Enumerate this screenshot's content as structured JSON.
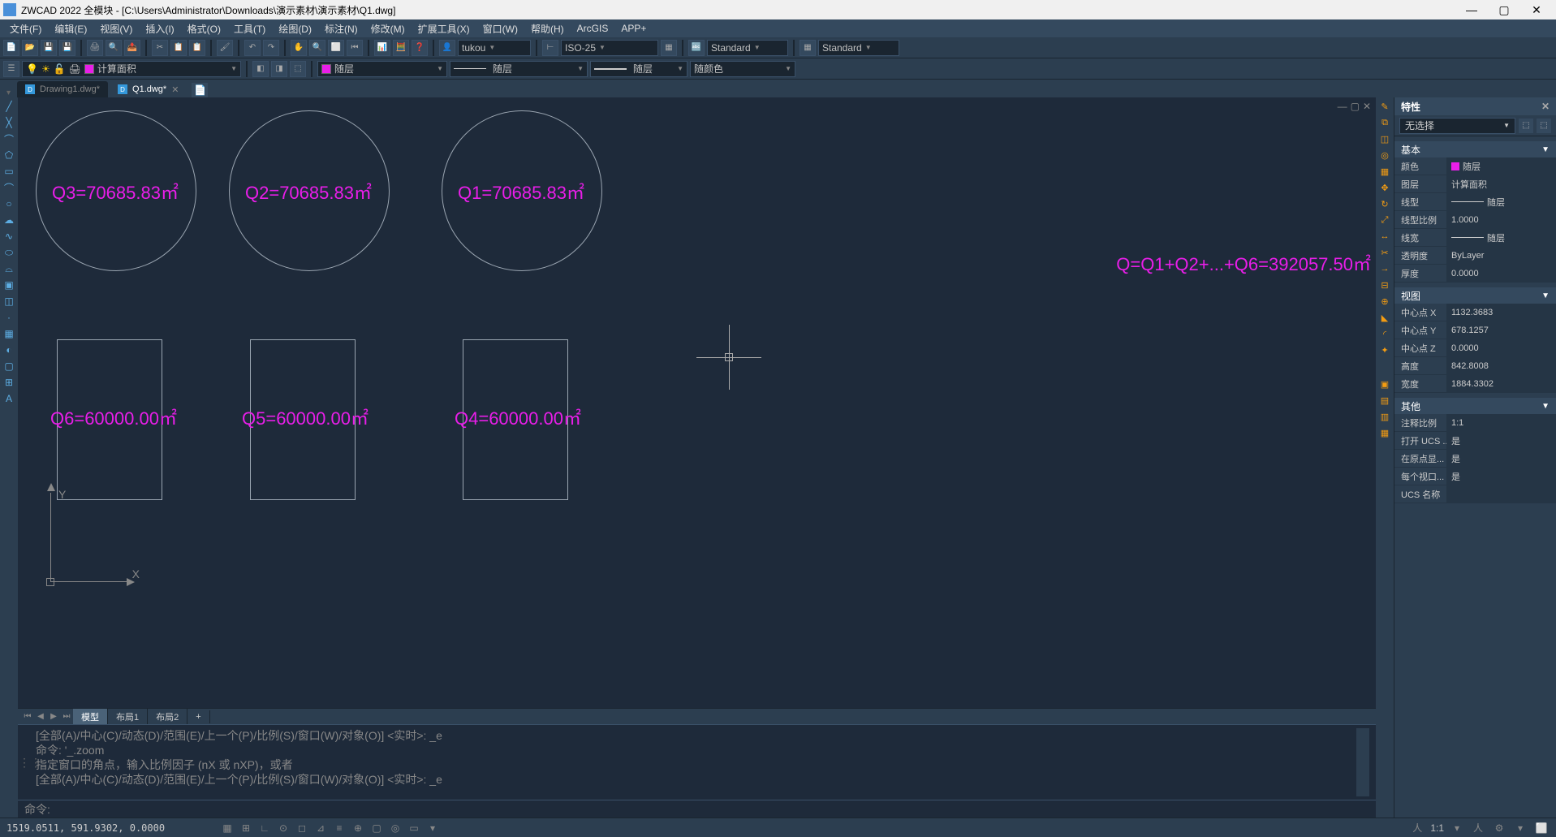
{
  "titlebar": {
    "title": "ZWCAD 2022 全模块 - [C:\\Users\\Administrator\\Downloads\\演示素材\\演示素材\\Q1.dwg]"
  },
  "menu": {
    "items": [
      "文件(F)",
      "编辑(E)",
      "视图(V)",
      "插入(I)",
      "格式(O)",
      "工具(T)",
      "绘图(D)",
      "标注(N)",
      "修改(M)",
      "扩展工具(X)",
      "窗口(W)",
      "帮助(H)",
      "ArcGIS",
      "APP+"
    ]
  },
  "toolbar1": {
    "combo1": "tukou",
    "combo2": "ISO-25",
    "combo3": "Standard",
    "combo4": "Standard"
  },
  "toolbar2": {
    "layer": "计算面积",
    "linetype_combo": "随层",
    "lineweight_combo": "随层",
    "color_combo": "随颜色",
    "plot_combo": "随层"
  },
  "tabs": {
    "t1": "Drawing1.dwg*",
    "t2": "Q1.dwg*"
  },
  "drawing": {
    "q1": "Q1=70685.83㎡",
    "q2": "Q2=70685.83㎡",
    "q3": "Q3=70685.83㎡",
    "q4": "Q4=60000.00㎡",
    "q5": "Q5=60000.00㎡",
    "q6": "Q6=60000.00㎡",
    "sum": "Q=Q1+Q2+...+Q6=392057.50㎡",
    "ylab": "Y",
    "xlab": "X"
  },
  "layout": {
    "model": "模型",
    "l1": "布局1",
    "l2": "布局2",
    "plus": "+"
  },
  "cmd": {
    "line1": "[全部(A)/中心(C)/动态(D)/范围(E)/上一个(P)/比例(S)/窗口(W)/对象(O)] <实时>: _e",
    "line2": "命令: '_.zoom",
    "line3": "指定窗口的角点，输入比例因子 (nX 或 nXP)，或者",
    "line4": "[全部(A)/中心(C)/动态(D)/范围(E)/上一个(P)/比例(S)/窗口(W)/对象(O)] <实时>: _e",
    "prompt": "命令:",
    "input": ""
  },
  "props": {
    "title": "特性",
    "selection": "无选择",
    "sec_basic": "基本",
    "color_l": "颜色",
    "color_v": "随层",
    "layer_l": "图层",
    "layer_v": "计算面积",
    "ltype_l": "线型",
    "ltype_v": "随层",
    "ltscale_l": "线型比例",
    "ltscale_v": "1.0000",
    "lweight_l": "线宽",
    "lweight_v": "随层",
    "trans_l": "透明度",
    "trans_v": "ByLayer",
    "thick_l": "厚度",
    "thick_v": "0.0000",
    "sec_view": "视图",
    "cx_l": "中心点 X",
    "cx_v": "1132.3683",
    "cy_l": "中心点 Y",
    "cy_v": "678.1257",
    "cz_l": "中心点 Z",
    "cz_v": "0.0000",
    "h_l": "高度",
    "h_v": "842.8008",
    "w_l": "宽度",
    "w_v": "1884.3302",
    "sec_other": "其他",
    "ascale_l": "注释比例",
    "ascale_v": "1:1",
    "ucs1_l": "打开 UCS ...",
    "ucs1_v": "是",
    "ucs2_l": "在原点显...",
    "ucs2_v": "是",
    "ucs3_l": "每个视口...",
    "ucs3_v": "是",
    "ucsn_l": "UCS 名称",
    "ucsn_v": ""
  },
  "status": {
    "coords": "1519.0511, 591.9302, 0.0000",
    "scale": "1:1"
  }
}
